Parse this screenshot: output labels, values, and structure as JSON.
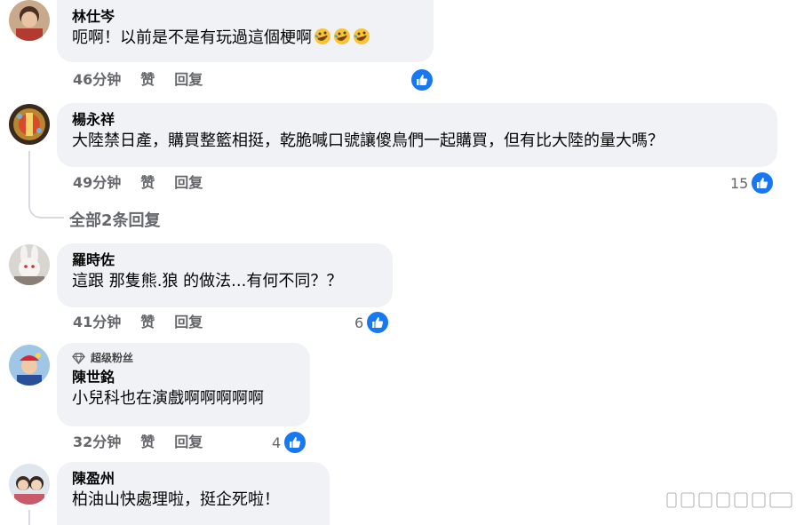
{
  "comments": [
    {
      "name": "林仕岑",
      "text": "呃啊！以前是不是有玩過這個梗啊",
      "emojis": [
        "rolling-laugh-emoji",
        "rolling-laugh-emoji",
        "rolling-laugh-emoji"
      ],
      "time": "46分钟",
      "like_label": "赞",
      "reply_label": "回复",
      "reaction_count": ""
    },
    {
      "name": "楊永祥",
      "text": "大陸禁日產，購買整籃相挺，乾脆喊口號讓傻鳥們一起購買，但有比大陸的量大嗎？",
      "time": "49分钟",
      "like_label": "赞",
      "reply_label": "回复",
      "reaction_count": "15"
    },
    {
      "name": "羅時佐",
      "text": "這跟 那隻熊.狼 的做法...有何不同？？",
      "time": "41分钟",
      "like_label": "赞",
      "reply_label": "回复",
      "reaction_count": "6"
    },
    {
      "badge": "超级粉丝",
      "name": "陳世銘",
      "text": "小兒科也在演戲啊啊啊啊啊",
      "time": "32分钟",
      "like_label": "赞",
      "reply_label": "回复",
      "reaction_count": "4"
    },
    {
      "name": "陳盈州",
      "text": "柏油山快處理啦，挺企死啦！"
    }
  ],
  "view_replies": "全部2条回复",
  "colors": {
    "bubble": "#f0f2f5",
    "like_blue": "#1877f2",
    "meta_gray": "#65676b"
  }
}
